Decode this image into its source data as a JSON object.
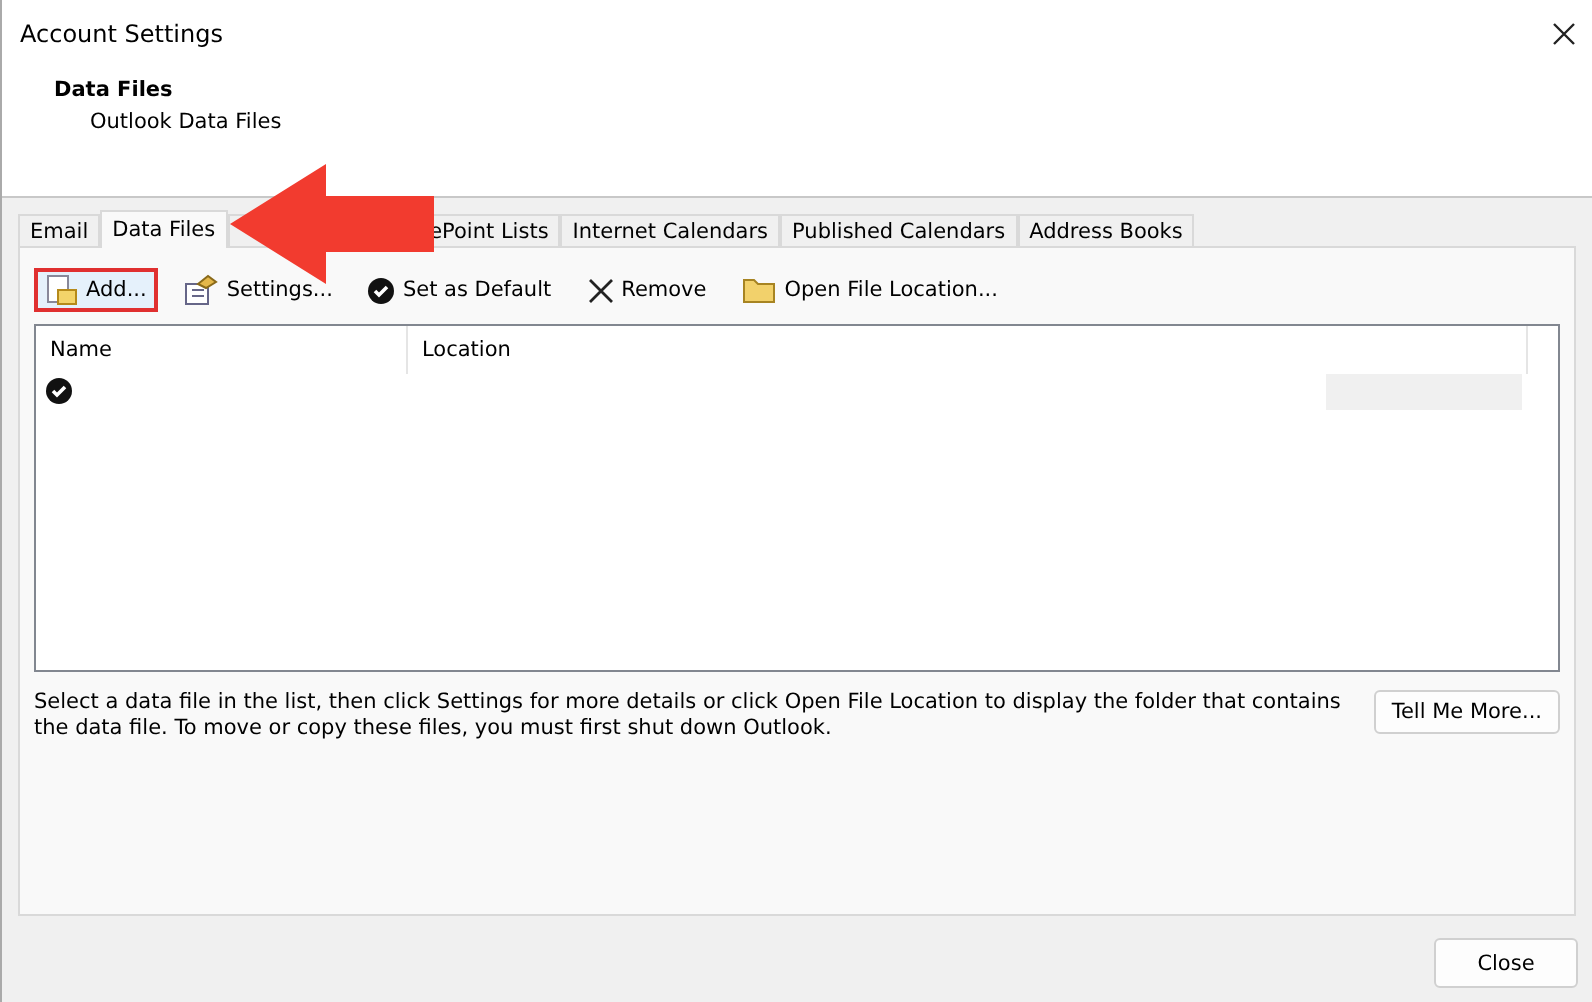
{
  "window": {
    "title": "Account Settings"
  },
  "header": {
    "title": "Data Files",
    "subtitle": "Outlook Data Files"
  },
  "tabs": [
    {
      "label": "Email",
      "selected": false
    },
    {
      "label": "Data Files",
      "selected": true
    },
    {
      "label": "ePoint Lists",
      "selected": false
    },
    {
      "label": "Internet Calendars",
      "selected": false
    },
    {
      "label": "Published Calendars",
      "selected": false
    },
    {
      "label": "Address Books",
      "selected": false
    }
  ],
  "toolbar": [
    {
      "kind": "add",
      "label": "Add...",
      "highlighted": true
    },
    {
      "kind": "settings",
      "label": "Settings...",
      "highlighted": false
    },
    {
      "kind": "default",
      "label": "Set as Default",
      "highlighted": false
    },
    {
      "kind": "remove",
      "label": "Remove",
      "highlighted": false
    },
    {
      "kind": "folder",
      "label": "Open File Location...",
      "highlighted": false
    }
  ],
  "table": {
    "columns": [
      "Name",
      "Location"
    ],
    "rows": [
      {
        "is_default": true
      }
    ]
  },
  "description": "Select a data file in the list, then click Settings for more details or click Open File Location to display the folder that contains the data file. To move or copy these files, you must first shut down Outlook.",
  "tell_me_more": "Tell Me More...",
  "close_button": "Close"
}
